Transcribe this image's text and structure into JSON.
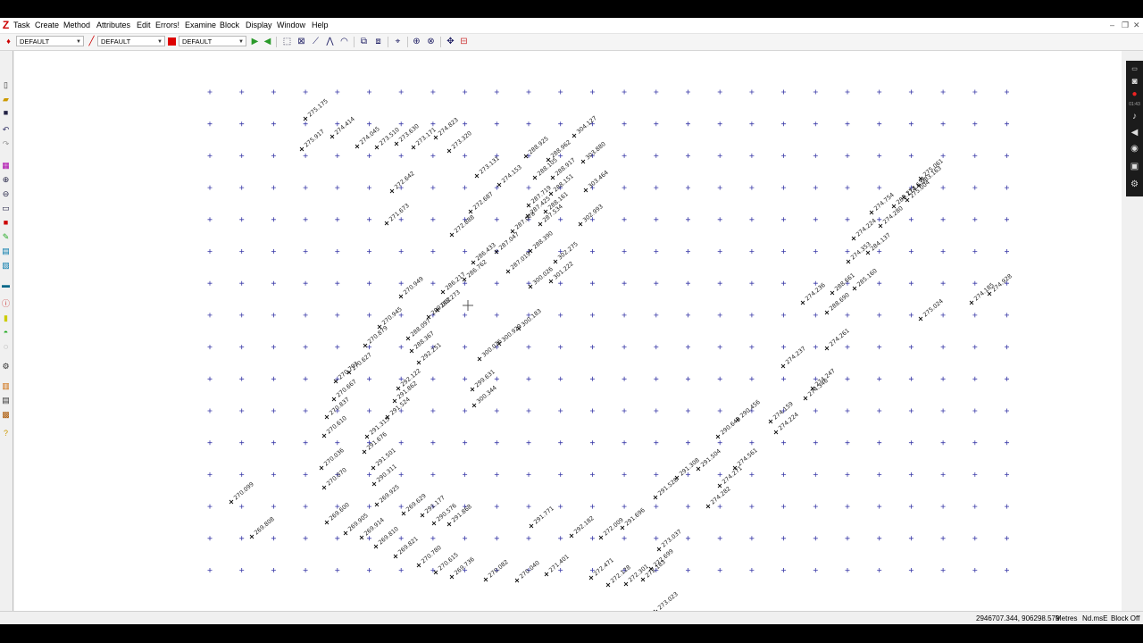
{
  "menu": [
    "Task",
    "Create",
    "Method",
    "Attributes",
    "Edit",
    "Errors!",
    "Examine",
    "Block",
    "Display",
    "Window",
    "Help"
  ],
  "toolbar": {
    "layer": "DEFAULT",
    "linestyle": "DEFAULT",
    "color_value": "DEFAULT",
    "color_swatch": "#dd0000"
  },
  "recorder": {
    "time": "01:43"
  },
  "status": {
    "coords": "2946707.344, 906298.579",
    "units": "Metres",
    "file": "Nd.msE",
    "block": "Block Off"
  },
  "labels": [
    {
      "t": "275.175"
    },
    {
      "t": "274.414"
    },
    {
      "t": "274.045"
    },
    {
      "t": "273.510"
    },
    {
      "t": "273.630"
    },
    {
      "t": "273.171"
    },
    {
      "t": "274.823"
    },
    {
      "t": "275.917"
    },
    {
      "t": "273.320"
    },
    {
      "t": "304.127"
    },
    {
      "t": "288.925"
    },
    {
      "t": "288.962"
    },
    {
      "t": "303.880"
    },
    {
      "t": "273.131"
    },
    {
      "t": "274.153"
    },
    {
      "t": "288.105"
    },
    {
      "t": "288.917"
    },
    {
      "t": "303.464"
    },
    {
      "t": "272.642"
    },
    {
      "t": "288.151"
    },
    {
      "t": "287.719"
    },
    {
      "t": "288.161"
    },
    {
      "t": "272.687"
    },
    {
      "t": "287.425"
    },
    {
      "t": "271.673"
    },
    {
      "t": "287.078"
    },
    {
      "t": "287.534"
    },
    {
      "t": "302.993"
    },
    {
      "t": "272.888"
    },
    {
      "t": "287.047"
    },
    {
      "t": "288.390"
    },
    {
      "t": "286.433"
    },
    {
      "t": "287.019"
    },
    {
      "t": "302.275"
    },
    {
      "t": "286.762"
    },
    {
      "t": "300.026"
    },
    {
      "t": "301.222"
    },
    {
      "t": "286.217"
    },
    {
      "t": "270.949"
    },
    {
      "t": "288.273"
    },
    {
      "t": "289.002"
    },
    {
      "t": "270.945"
    },
    {
      "t": "300.183"
    },
    {
      "t": "288.097"
    },
    {
      "t": "300.929"
    },
    {
      "t": "270.879"
    },
    {
      "t": "288.367"
    },
    {
      "t": "292.251"
    },
    {
      "t": "300.076"
    },
    {
      "t": "270.703"
    },
    {
      "t": "270.627"
    },
    {
      "t": "292.122"
    },
    {
      "t": "299.631"
    },
    {
      "t": "270.667"
    },
    {
      "t": "291.862"
    },
    {
      "t": "300.344"
    },
    {
      "t": "270.837"
    },
    {
      "t": "291.524"
    },
    {
      "t": "270.610"
    },
    {
      "t": "291.315"
    },
    {
      "t": "291.676"
    },
    {
      "t": "270.036"
    },
    {
      "t": "291.501"
    },
    {
      "t": "270.070"
    },
    {
      "t": "290.311"
    },
    {
      "t": "270.099"
    },
    {
      "t": "269.925"
    },
    {
      "t": "269.600"
    },
    {
      "t": "269.629"
    },
    {
      "t": "291.177"
    },
    {
      "t": "290.576"
    },
    {
      "t": "291.868"
    },
    {
      "t": "269.808"
    },
    {
      "t": "269.905"
    },
    {
      "t": "269.914"
    },
    {
      "t": "269.810"
    },
    {
      "t": "269.821"
    },
    {
      "t": "270.780"
    },
    {
      "t": "270.615"
    },
    {
      "t": "269.736"
    },
    {
      "t": "270.082"
    },
    {
      "t": "270.040"
    },
    {
      "t": "271.401"
    },
    {
      "t": "291.771"
    },
    {
      "t": "292.182"
    },
    {
      "t": "272.009"
    },
    {
      "t": "272.471"
    },
    {
      "t": "272.128"
    },
    {
      "t": "272.301"
    },
    {
      "t": "272.183"
    },
    {
      "t": "272.699"
    },
    {
      "t": "273.037"
    },
    {
      "t": "273.023"
    },
    {
      "t": "291.696"
    },
    {
      "t": "291.528"
    },
    {
      "t": "291.308"
    },
    {
      "t": "291.504"
    },
    {
      "t": "274.282"
    },
    {
      "t": "274.271"
    },
    {
      "t": "274.561"
    },
    {
      "t": "274.159"
    },
    {
      "t": "290.648"
    },
    {
      "t": "290.456"
    },
    {
      "t": "274.224"
    },
    {
      "t": "274.346"
    },
    {
      "t": "274.247"
    },
    {
      "t": "274.261"
    },
    {
      "t": "274.237"
    },
    {
      "t": "288.690"
    },
    {
      "t": "274.236"
    },
    {
      "t": "288.661"
    },
    {
      "t": "285.160"
    },
    {
      "t": "274.353"
    },
    {
      "t": "284.137"
    },
    {
      "t": "274.224"
    },
    {
      "t": "274.280"
    },
    {
      "t": "274.754"
    },
    {
      "t": "283.114"
    },
    {
      "t": "275.004"
    },
    {
      "t": "283.163"
    },
    {
      "t": "275.061"
    },
    {
      "t": "273.637"
    },
    {
      "t": "275.024"
    },
    {
      "t": "274.185"
    },
    {
      "t": "274.928"
    }
  ]
}
